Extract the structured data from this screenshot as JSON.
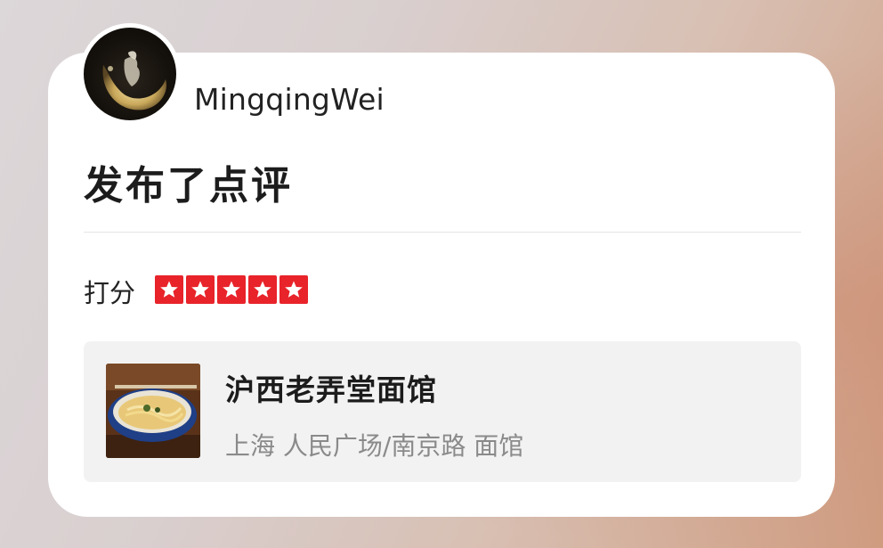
{
  "post": {
    "username": "MingqingWei",
    "action": "发布了点评"
  },
  "rating": {
    "label": "打分",
    "stars": 5,
    "max": 5,
    "star_color": "#e8232a"
  },
  "shop": {
    "name": "沪西老弄堂面馆",
    "meta": "上海 人民广场/南京路 面馆",
    "thumb_icon": "noodle-bowl-photo"
  },
  "avatar": {
    "icon": "crescent-moon-avatar"
  }
}
